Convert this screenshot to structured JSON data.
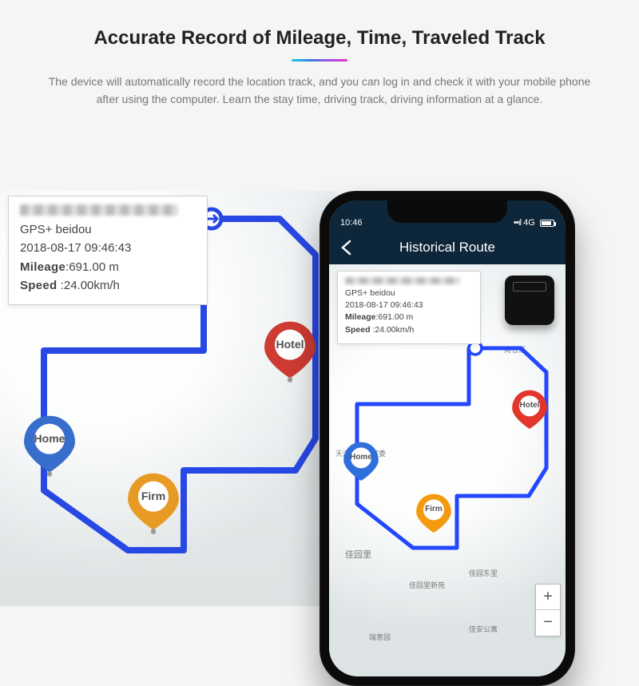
{
  "header": {
    "title": "Accurate Record of Mileage, Time, Traveled Track",
    "description": "The device will automatically record the location track, and you can log in and check it with your mobile phone after using the computer. Learn the stay time, driving track, driving information at a glance."
  },
  "tracking": {
    "positioning": "GPS+ beidou",
    "timestamp": "2018-08-17 09:46:43",
    "mileage_label": "Mileage",
    "mileage_value": ":691.00 m",
    "speed_label": "Speed",
    "speed_value": ":24.00km/h"
  },
  "pins": {
    "home": "Home",
    "hotel": "Hotel",
    "firm": "Firm"
  },
  "phone": {
    "status_time": "10:46",
    "status_net": "4G",
    "app_title": "Historical Route",
    "roads": {
      "a": "南仓道",
      "b": "天津市人大常委",
      "c": "佳园里",
      "d": "佳园里新苑",
      "e": "佳园东里",
      "f": "瑞意园",
      "g": "佳安公寓"
    }
  },
  "colors": {
    "home": "#2f6fdc",
    "hotel": "#e2362c",
    "firm": "#f49a0e",
    "route": "#2247ff"
  }
}
